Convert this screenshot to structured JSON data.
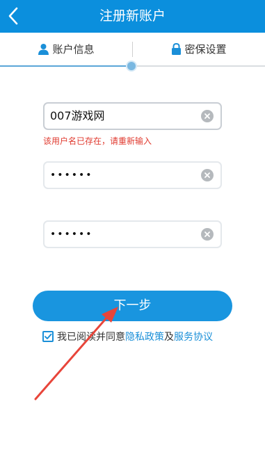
{
  "header": {
    "title": "注册新账户",
    "back_icon": "chevron-left-icon"
  },
  "steps": [
    {
      "label": "账户信息",
      "icon": "user-icon",
      "active": true
    },
    {
      "label": "密保设置",
      "icon": "lock-icon",
      "active": false
    }
  ],
  "progress": {
    "fraction": 0.5
  },
  "form": {
    "username": {
      "value": "007游戏网"
    },
    "error": "该用户名已存在，请重新输入",
    "password": {
      "value": "••••••"
    },
    "confirm_password": {
      "value": "••••••"
    }
  },
  "next_button": {
    "label": "下一步"
  },
  "agreement": {
    "checked": true,
    "prefix": "我已阅读并同意",
    "privacy_link": "隐私政策",
    "and": "及",
    "service_link": "服务协议"
  },
  "colors": {
    "header_bg": "#0b8fdd",
    "primary": "#1995df",
    "error": "#e03a2f",
    "annotation_arrow": "#e8453a"
  }
}
